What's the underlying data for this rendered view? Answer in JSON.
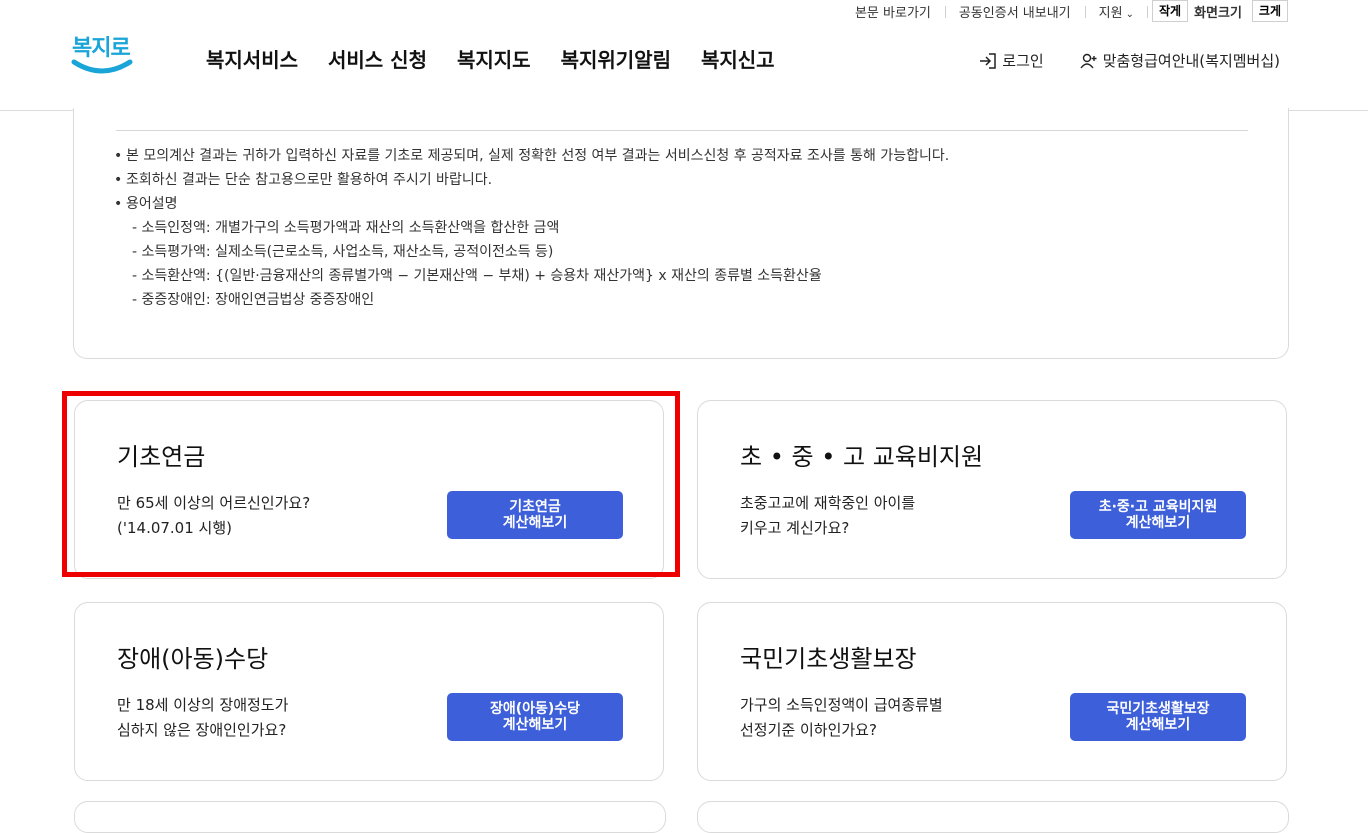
{
  "header": {
    "logo_text": "복지로",
    "util_links": [
      "본문 바로가기",
      "공동인증서 내보내기",
      "지원"
    ],
    "font_size_label": "화면크기",
    "font_small": "작게",
    "font_large": "크게",
    "nav": [
      "복지서비스",
      "서비스 신청",
      "복지지도",
      "복지위기알림",
      "복지신고"
    ],
    "login": "로그인",
    "custom_info": "맞춤형급여안내(복지멤버십)"
  },
  "notice": {
    "bullets": [
      "본 모의계산 결과는 귀하가 입력하신 자료를 기초로 제공되며, 실제 정확한 선정 여부 결과는 서비스신청 후 공적자료 조사를 통해 가능합니다.",
      "조회하신 결과는 단순 참고용으로만 활용하여 주시기 바랍니다.",
      "용어설명"
    ],
    "terms": [
      "- 소득인정액: 개별가구의 소득평가액과 재산의 소득환산액을 합산한 금액",
      "- 소득평가액: 실제소득(근로소득, 사업소득, 재산소득, 공적이전소득 등)",
      "- 소득환산액: {(일반·금융재산의 종류별가액 − 기본재산액 − 부채) + 승용차 재산가액} x 재산의 종류별 소득환산율",
      "- 중증장애인: 장애인연금법상 중증장애인"
    ]
  },
  "cards": [
    {
      "title": "기초연금",
      "desc1": "만 65세 이상의 어르신인가요?",
      "desc2": "('14.07.01 시행)",
      "btn1": "기초연금",
      "btn2": "계산해보기"
    },
    {
      "title": "초 • 중 • 고 교육비지원",
      "desc1": "초중고교에 재학중인 아이를",
      "desc2": "키우고 계신가요?",
      "btn1": "초·중·고 교육비지원",
      "btn2": "계산해보기"
    },
    {
      "title": "장애(아동)수당",
      "desc1": "만 18세 이상의 장애정도가",
      "desc2": "심하지 않은 장애인인가요?",
      "btn1": "장애(아동)수당",
      "btn2": "계산해보기"
    },
    {
      "title": "국민기초생활보장",
      "desc1": "가구의 소득인정액이 급여종류별",
      "desc2": "선정기준 이하인가요?",
      "btn1": "국민기초생활보장",
      "btn2": "계산해보기"
    }
  ],
  "colors": {
    "accent": "#3d5fd9",
    "highlight": "#ee0000",
    "logo": "#1aa5d8"
  }
}
